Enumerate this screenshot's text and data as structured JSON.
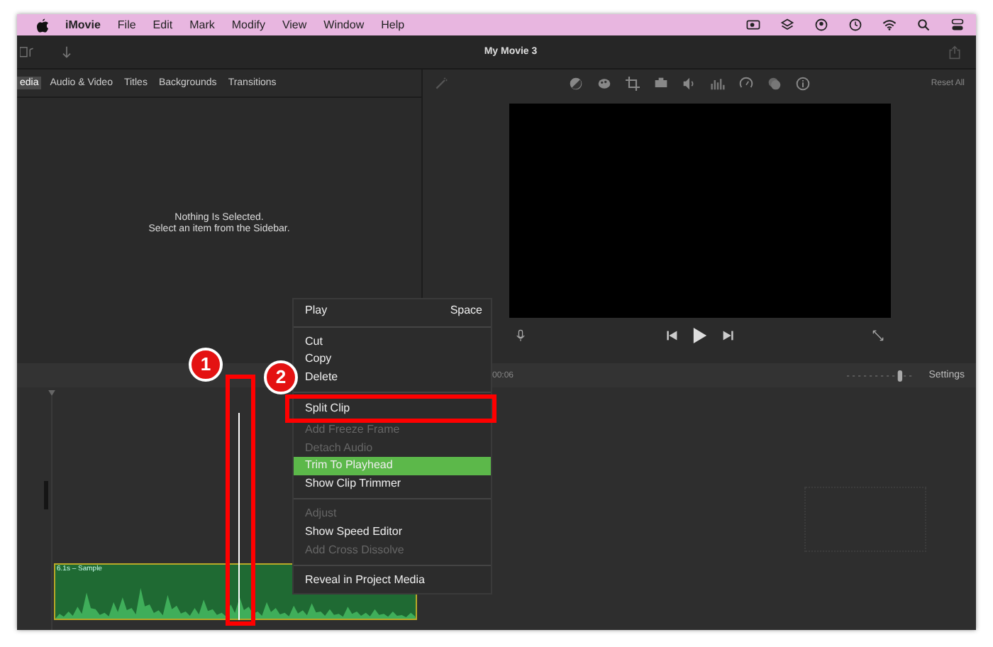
{
  "menu_bar": {
    "items": [
      "iMovie",
      "File",
      "Edit",
      "Mark",
      "Modify",
      "View",
      "Window",
      "Help"
    ]
  },
  "toolbar": {
    "title": "My Movie 3"
  },
  "browser": {
    "tabs": [
      {
        "label": "edia",
        "selected": true
      },
      {
        "label": "Audio & Video",
        "selected": false
      },
      {
        "label": "Titles",
        "selected": false
      },
      {
        "label": "Backgrounds",
        "selected": false
      },
      {
        "label": "Transitions",
        "selected": false
      }
    ],
    "message": [
      "Nothing Is Selected.",
      "Select an item from the Sidebar."
    ]
  },
  "viewer": {
    "reset": "Reset All"
  },
  "timeline": {
    "timecode": "00:06",
    "zoom": {
      "level": 0.8
    },
    "settings": "Settings",
    "clip": {
      "label": "6.1s – Sample"
    }
  },
  "context_menu": [
    {
      "kind": "item",
      "label": "Play",
      "shortcut": "Space",
      "disabled": false,
      "selected": false
    },
    {
      "kind": "separator"
    },
    {
      "kind": "item",
      "label": "Cut",
      "disabled": false,
      "selected": false
    },
    {
      "kind": "item",
      "label": "Copy",
      "disabled": false,
      "selected": false
    },
    {
      "kind": "item",
      "label": "Delete",
      "disabled": false,
      "selected": false
    },
    {
      "kind": "separator"
    },
    {
      "kind": "item",
      "label": "Split Clip",
      "disabled": false,
      "selected": false,
      "framed": true
    },
    {
      "kind": "item",
      "label": "Add Freeze Frame",
      "disabled": true,
      "selected": false
    },
    {
      "kind": "item",
      "label": "Detach Audio",
      "disabled": true,
      "selected": false
    },
    {
      "kind": "item",
      "label": "Trim To Playhead",
      "disabled": false,
      "selected": true
    },
    {
      "kind": "item",
      "label": "Show Clip Trimmer",
      "disabled": false,
      "selected": false
    },
    {
      "kind": "separator"
    },
    {
      "kind": "item",
      "label": "Adjust",
      "disabled": true,
      "selected": false
    },
    {
      "kind": "item",
      "label": "Show Speed Editor",
      "disabled": false,
      "selected": false
    },
    {
      "kind": "item",
      "label": "Add Cross Dissolve",
      "disabled": true,
      "selected": false
    },
    {
      "kind": "separator"
    },
    {
      "kind": "item",
      "label": "Reveal in Project Media",
      "disabled": false,
      "selected": false
    }
  ],
  "annotations": [
    {
      "label": "1"
    },
    {
      "label": "2"
    }
  ]
}
